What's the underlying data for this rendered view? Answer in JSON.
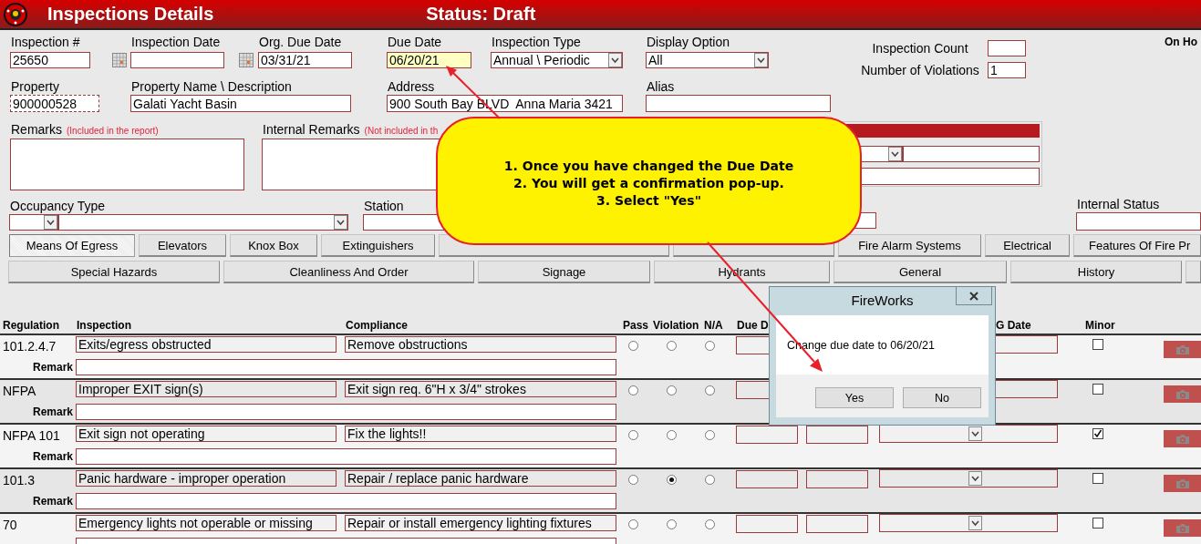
{
  "title_bar": {
    "title": "Inspections Details",
    "status": "Status: Draft"
  },
  "inspection_number": {
    "label": "Inspection #",
    "value": "25650"
  },
  "inspection_date": {
    "label": "Inspection Date"
  },
  "org_due_date": {
    "label": "Org. Due Date",
    "value": "03/31/21"
  },
  "due_date": {
    "label": "Due Date",
    "value": "06/20/21",
    "highlighted": true
  },
  "inspection_type": {
    "label": "Inspection Type",
    "value": "Annual \\ Periodic"
  },
  "display_option": {
    "label": "Display Option",
    "value": "All"
  },
  "inspection_count": {
    "label": "Inspection Count"
  },
  "number_of_violations": {
    "label": "Number of Violations",
    "value": "1"
  },
  "corner_label": "On Ho",
  "property": {
    "label": "Property",
    "value": "900000528"
  },
  "property_name": {
    "label": "Property Name \\ Description",
    "value": "Galati Yacht Basin"
  },
  "address": {
    "label": "Address",
    "value": "900 South Bay BLVD  Anna Maria 3421"
  },
  "alias": {
    "label": "Alias"
  },
  "remarks": {
    "label": "Remarks",
    "note": "(Included in the report)"
  },
  "internal_remarks": {
    "label": "Internal Remarks",
    "note": "(Not included in th"
  },
  "occupancy_type": {
    "label": "Occupancy Type"
  },
  "station": {
    "label": "Station"
  },
  "internal_status": {
    "label": "Internal Status"
  },
  "tab_rows": [
    {
      "tabs": [
        {
          "label": "Means Of Egress",
          "selected": true
        },
        {
          "label": "Elevators",
          "selected": false
        },
        {
          "label": "Knox Box",
          "selected": false
        },
        {
          "label": "Extinguishers",
          "selected": false
        },
        {
          "selected": false
        },
        {
          "selected": false
        },
        {
          "label": "Fire Alarm Systems",
          "selected": false
        },
        {
          "label": "Electrical",
          "selected": false
        },
        {
          "label": "Features Of Fire Pr",
          "selected": false
        }
      ]
    },
    {
      "tabs": [
        {
          "label": "Special Hazards",
          "selected": false
        },
        {
          "label": "Cleanliness And Order",
          "selected": false
        },
        {
          "label": "Signage",
          "selected": false
        },
        {
          "label": "Hydrants",
          "selected": false
        },
        {
          "label": "General",
          "selected": false
        },
        {
          "label": "History",
          "selected": false
        }
      ]
    }
  ],
  "table": {
    "columns": [
      "Regulation",
      "Inspection",
      "Compliance",
      "Pass",
      "Violation",
      "N/A",
      "Due D",
      "G Date",
      "Minor"
    ],
    "rows": [
      {
        "regulation": "101.2.4.7",
        "inspection": "Exits/egress obstructed",
        "compliance": "Remove obstructions",
        "pass": false,
        "violation": false,
        "na": false,
        "minor": false,
        "remark_label": "Remark"
      },
      {
        "regulation": "NFPA",
        "inspection": "Improper EXIT sign(s)",
        "compliance": "Exit sign req. 6\"H x 3/4\" strokes",
        "pass": false,
        "violation": false,
        "na": false,
        "minor": false,
        "remark_label": "Remark"
      },
      {
        "regulation": "NFPA 101",
        "inspection": "Exit sign not operating",
        "compliance": "Fix the lights!!",
        "pass": false,
        "violation": false,
        "na": false,
        "minor": true,
        "remark_label": "Remark"
      },
      {
        "regulation": "101.3",
        "inspection": "Panic hardware - improper operation",
        "compliance": "Repair / replace panic hardware",
        "pass": false,
        "violation": true,
        "na": false,
        "minor": false,
        "remark_label": "Remark"
      },
      {
        "regulation": "70",
        "inspection": "Emergency lights not operable or missing",
        "compliance": "Repair or install emergency lighting fixtures",
        "pass": false,
        "violation": false,
        "na": false,
        "minor": false
      }
    ]
  },
  "callout": {
    "lines": [
      "1. Once you have changed the Due Date",
      "2. You will get a confirmation pop-up.",
      "3. Select \"Yes\""
    ]
  },
  "dialog": {
    "title": "FireWorks",
    "message": "Change due date to 06/20/21",
    "buttons": [
      "Yes",
      "No"
    ]
  }
}
